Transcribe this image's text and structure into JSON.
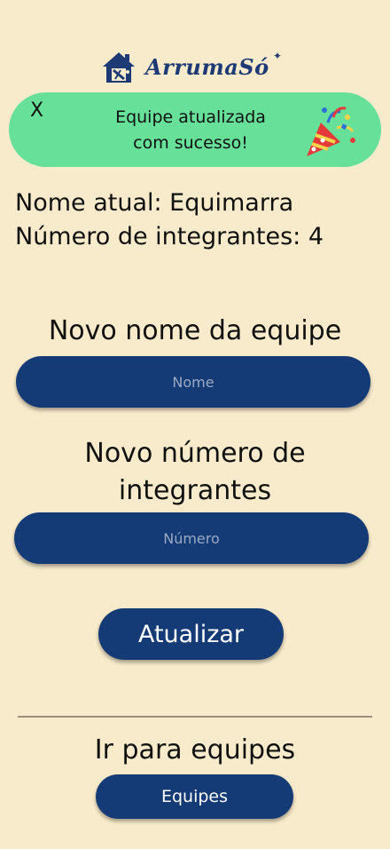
{
  "app": {
    "logo_text": "ArrumaSó"
  },
  "toast": {
    "close_label": "X",
    "message_line1": "Equipe atualizada",
    "message_line2": "com sucesso!"
  },
  "current": {
    "name_line": "Nome atual: Equimarra",
    "members_line": "Número de integrantes: 4"
  },
  "form": {
    "name_label": "Novo nome da equipe",
    "name_placeholder": "Nome",
    "members_label_line1": "Novo número de",
    "members_label_line2": "integrantes",
    "members_placeholder": "Número",
    "submit_label": "Atualizar"
  },
  "nav": {
    "heading": "Ir para equipes",
    "button_label": "Equipes"
  },
  "colors": {
    "background": "#f8ebcb",
    "primary": "#153b76",
    "toast": "#67e09a"
  }
}
